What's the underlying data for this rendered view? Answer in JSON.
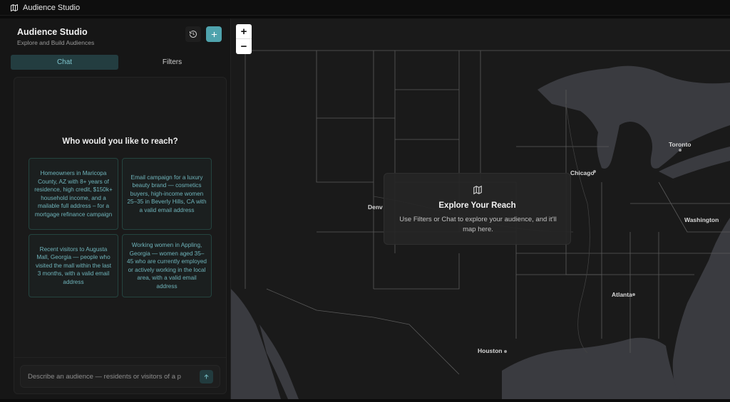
{
  "app": {
    "window_title": "Audience Studio"
  },
  "sidebar": {
    "title": "Audience Studio",
    "subtitle": "Explore and Build Audiences",
    "tabs": [
      {
        "label": "Chat"
      },
      {
        "label": "Filters"
      }
    ],
    "chat": {
      "question": "Who would you like to reach?",
      "suggestions": [
        {
          "text": "Homeowners in Maricopa County, AZ with 8+ years of residence, high credit, $150k+ household income, and a mailable full address – for a mortgage refinance campaign"
        },
        {
          "text": "Email campaign for a luxury beauty brand — cosmetics buyers, high-income women 25–35 in Beverly Hills, CA with a valid email address"
        },
        {
          "text": "Recent visitors to Augusta Mall, Georgia — people who visited the mall within the last 3 months, with a valid email address"
        },
        {
          "text": "Working women in Appling, Georgia — women aged 35–45 who are currently employed or actively working in the local area, with a valid email address"
        }
      ],
      "input_placeholder": "Describe an audience — residents or visitors of a p"
    }
  },
  "map": {
    "zoom_in": "+",
    "zoom_out": "−",
    "cities": [
      {
        "name": "Toronto"
      },
      {
        "name": "Chicago"
      },
      {
        "name": "Denv"
      },
      {
        "name": "Washington"
      },
      {
        "name": "Atlanta"
      },
      {
        "name": "Houston"
      }
    ],
    "overlay": {
      "title": "Explore Your Reach",
      "text": "Use Filters or Chat to explore your audience, and it'll map here."
    }
  },
  "colors": {
    "accent": "#4fa3ad",
    "map_land": "#1a1a1a",
    "map_water": "#3a3b40"
  },
  "icons": {
    "topbar": "map-icon",
    "history": "history-icon",
    "add": "plus-icon",
    "send": "arrow-up-icon",
    "overlay": "map-icon"
  }
}
